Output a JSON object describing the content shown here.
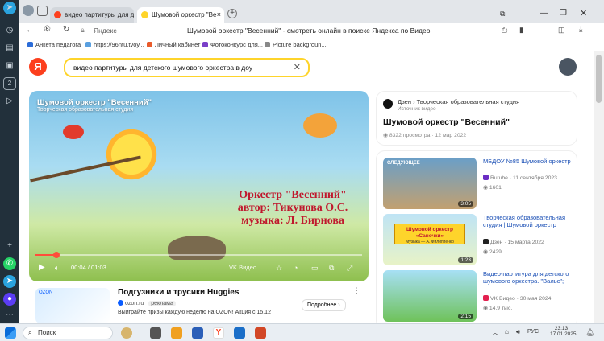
{
  "sidebar": {
    "icons": [
      "telegram-icon",
      "clock-icon",
      "bookmark-icon",
      "folder-icon",
      "tab-icon",
      "number-2-icon",
      "play-icon",
      "plus-icon",
      "whatsapp-icon",
      "telegram-icon",
      "messenger-icon",
      "grid-icon"
    ],
    "badge": "2"
  },
  "tabs": [
    {
      "label": "видео партитуры для де"
    },
    {
      "label": "Шумовой оркестр \"Ве"
    }
  ],
  "address": {
    "site": "Яндекс",
    "title": "Шумовой оркестр \"Весенний\" - смотреть онлайн в поиске Яндекса по Видео"
  },
  "bookmarks": [
    "Анкета педагога",
    "https://96ntu.tvoy...",
    "Личный кабинет",
    "Фотоконкурс для...",
    "Picture backgroun..."
  ],
  "search": {
    "logo": "Я",
    "query": "видео партитуры для детского шумового оркестра в доу"
  },
  "player": {
    "title": "Шумовой оркестр \"Весенний\"",
    "subtitle": "Творческая образовательная студия",
    "credits": [
      "Оркестр \"Весенний\"",
      "автор: Тикунова О.С.",
      "музыка: Л. Бирнова"
    ],
    "time": "00:04 / 01:03",
    "progress": 0.063,
    "vk_label": "VK Видео"
  },
  "ad": {
    "title": "Подгузники и трусики Huggies",
    "domain": "ozon.ru",
    "tag": "реклама",
    "text": "Выиграйте призы каждую неделю на OZON! Акция с 15.12",
    "button": "Подробнее ›",
    "ozon_label": "OZON"
  },
  "info": {
    "channel": "Дзен › Творческая образовательная студия",
    "source": "Источник видео",
    "title": "Шумовой оркестр \"Весенний\"",
    "views": "8322 просмотра",
    "date": "12 мар 2022"
  },
  "related": [
    {
      "title": "МБДОУ №85 Шумовой оркестр",
      "source": "Rutube",
      "date": "11 сентября 2023",
      "views": "1601",
      "duration": "3:05",
      "label": "СЛЕДУЮЩЕЕ",
      "source_color": "#6b2dc4"
    },
    {
      "title": "Творческая образовательная студия | Шумовой оркестр",
      "source": "Дзен",
      "date": "15 марта 2022",
      "views": "2429",
      "duration": "1:23",
      "thumb_text": "Шумовой оркестр «Саночки»",
      "thumb_sub": "Музыка — А. Филиппенко",
      "source_color": "#222222"
    },
    {
      "title": "Видео-партитура для детского шумового оркестра. \"Вальс\";",
      "source": "VK Видео",
      "date": "30 мая 2024",
      "views": "14,9 тыс.",
      "duration": "2:15",
      "source_color": "#e3204f"
    }
  ],
  "taskbar": {
    "search": "Поиск",
    "lang": "РУС",
    "time": "23:13",
    "date": "17.01.2025"
  },
  "colors": {
    "yandex_yellow": "#fed42b",
    "link_blue": "#1a4fb5",
    "credit_red": "#c0182d"
  }
}
